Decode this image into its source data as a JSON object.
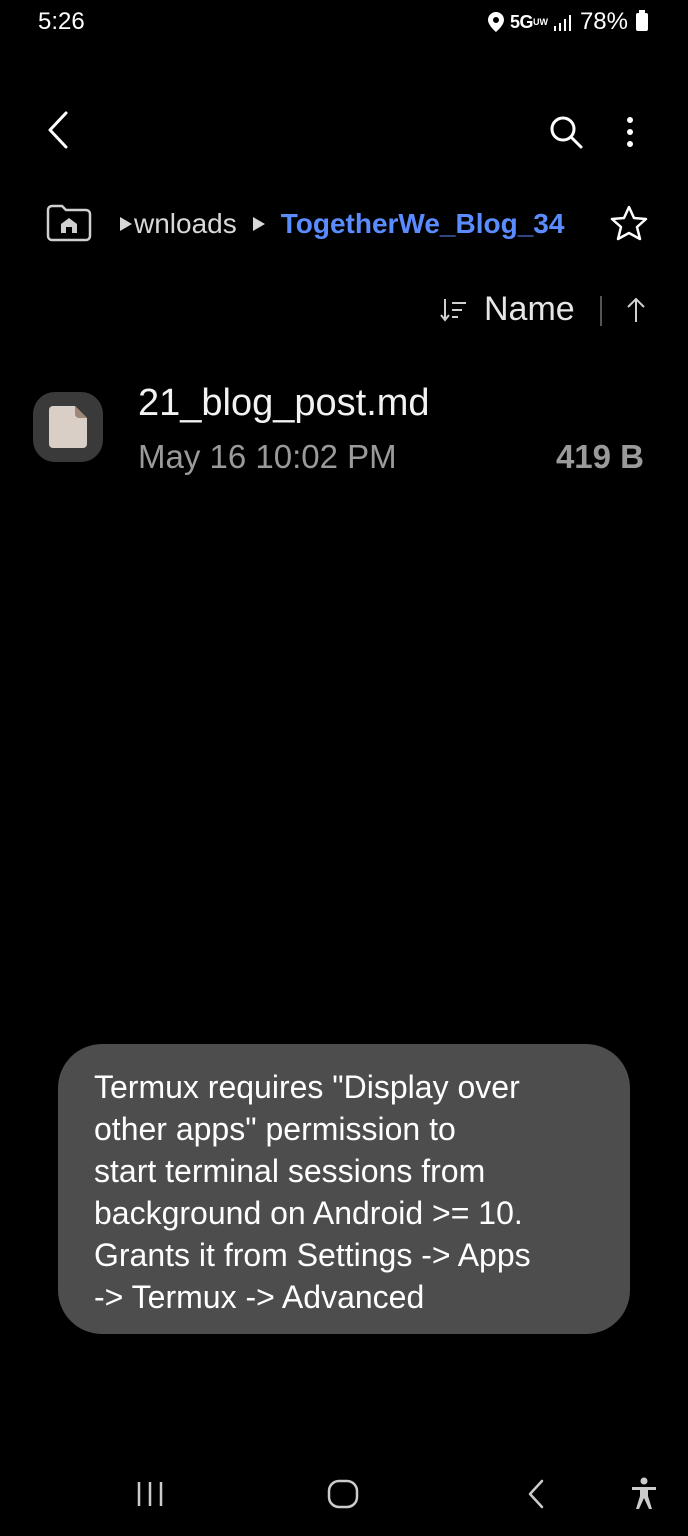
{
  "status_bar": {
    "time": "5:26",
    "network": "5G",
    "network_sub": "UW",
    "battery": "78%"
  },
  "toolbar": {
    "back_icon": "chevron-left-icon",
    "search_icon": "search-icon",
    "more_icon": "more-vertical-icon"
  },
  "breadcrumb": {
    "home_icon": "home-folder-icon",
    "parent": "wnloads",
    "current": "TogetherWe_Blog_34",
    "favorite_icon": "star-outline-icon"
  },
  "sort": {
    "label": "Name",
    "direction_icon": "arrow-up-icon"
  },
  "files": [
    {
      "name": "21_blog_post.md",
      "date": "May 16 10:02 PM",
      "size": "419 B",
      "icon": "document-icon"
    }
  ],
  "toast": {
    "message": "Termux requires \"Display over\nother apps\" permission to\nstart terminal sessions from\nbackground on Android >= 10.\nGrants it from Settings -> Apps\n-> Termux -> Advanced"
  },
  "nav_bar": {
    "recents_icon": "recents-icon",
    "home_icon": "home-icon",
    "back_icon": "back-icon",
    "accessibility_icon": "accessibility-icon"
  },
  "colors": {
    "background": "#000000",
    "accent": "#5b8cff",
    "toast_bg": "#4d4d4d"
  }
}
